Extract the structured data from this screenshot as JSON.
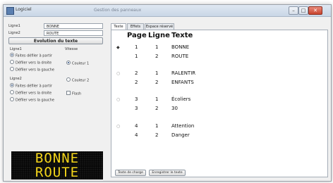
{
  "window": {
    "title": "Logiciel",
    "subtitle": "Gestion des panneaux",
    "buttons": [
      "minimize",
      "maximize",
      "close"
    ]
  },
  "left": {
    "line1": {
      "label": "Ligne1",
      "value": "BONNE"
    },
    "line2": {
      "label": "Ligne2",
      "value": "ROUTE"
    },
    "action_button": "Evolution du texte",
    "group_left_title": "Ligne1",
    "group_speed_title": "Vitesse",
    "line1_options": [
      {
        "label": "Faites défiler à partir",
        "checked": true
      },
      {
        "label": "Défiler vers la droite",
        "checked": false
      },
      {
        "label": "Défiler vers la gauche",
        "checked": false
      }
    ],
    "line2_title": "Ligne2",
    "line2_options": [
      {
        "label": "Faites défiler à partir",
        "checked": true
      },
      {
        "label": "Défiler vers la droite",
        "checked": false
      },
      {
        "label": "Défiler vers la gauche",
        "checked": false
      }
    ],
    "speed_options": [
      {
        "label": "Couleur 1",
        "checked": true
      },
      {
        "label": "Couleur 2",
        "checked": false
      }
    ],
    "flash_checkbox": {
      "label": "Flash",
      "checked": false
    },
    "display_line1": "BONNE",
    "display_line2": "ROUTE",
    "display_color": "#f4d51a"
  },
  "right": {
    "tabs": [
      {
        "label": "Texte",
        "active": true
      },
      {
        "label": "Effets",
        "active": false
      },
      {
        "label": "Espace réservé",
        "active": false
      }
    ],
    "columns": [
      "Page",
      "Ligne",
      "Texte"
    ],
    "rows": [
      {
        "page": "1",
        "ligne": "1",
        "texte": "BONNE",
        "selected": true
      },
      {
        "page": "1",
        "ligne": "2",
        "texte": "ROUTE",
        "selected": false
      },
      {
        "page": "2",
        "ligne": "1",
        "texte": "RALENTIR",
        "selected": false
      },
      {
        "page": "2",
        "ligne": "2",
        "texte": "ENFANTS",
        "selected": false
      },
      {
        "page": "3",
        "ligne": "1",
        "texte": "Écoliers",
        "selected": false
      },
      {
        "page": "3",
        "ligne": "2",
        "texte": "30",
        "selected": false
      },
      {
        "page": "4",
        "ligne": "1",
        "texte": "Attention",
        "selected": false
      },
      {
        "page": "4",
        "ligne": "2",
        "texte": "Danger",
        "selected": false
      }
    ],
    "buttons": [
      "Texte de charge",
      "Enregistrer le texte"
    ]
  }
}
